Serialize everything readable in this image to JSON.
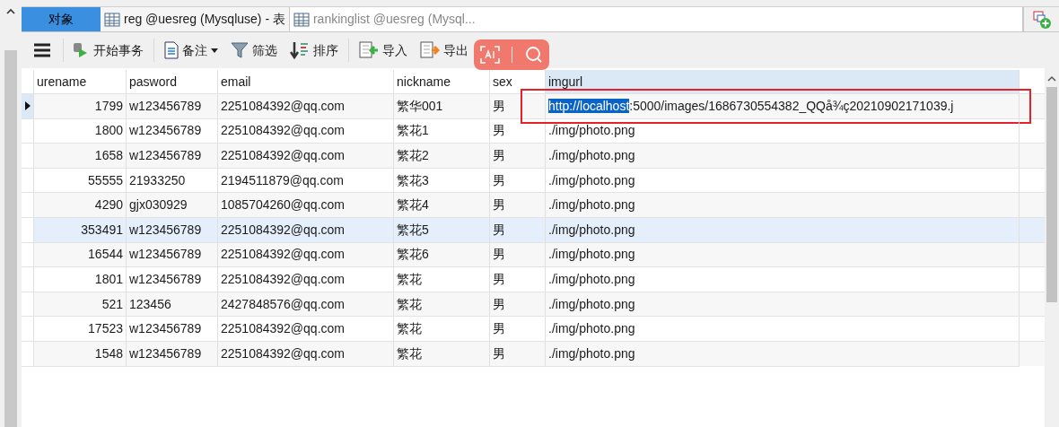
{
  "tabs": [
    {
      "label": "对象",
      "kind": "objects",
      "selected": false
    },
    {
      "label": "reg @uesreg (Mysqluse) - 表",
      "kind": "table",
      "selected": true
    },
    {
      "label": "rankinglist @uesreg (Mysql...",
      "kind": "table",
      "selected": false
    }
  ],
  "toolbar": [
    {
      "kind": "menu"
    },
    {
      "kind": "transaction",
      "label": "开始事务"
    },
    {
      "kind": "divider"
    },
    {
      "kind": "note",
      "label": "备注"
    },
    {
      "kind": "filter",
      "label": "筛选"
    },
    {
      "kind": "sort",
      "label": "排序"
    },
    {
      "kind": "divider"
    },
    {
      "kind": "import",
      "label": "导入"
    },
    {
      "kind": "export",
      "label": "导出"
    }
  ],
  "overlay": {
    "kind": "floating-tools"
  },
  "table": {
    "columns": [
      "urename",
      "pasword",
      "email",
      "nickname",
      "sex",
      "imgurl"
    ],
    "rows": [
      {
        "selected": true,
        "hovered": false,
        "annotated": true,
        "cells": [
          "1799",
          "w123456789",
          "2251084392@qq.com",
          "繁华001",
          "男"
        ],
        "imgurl": [
          {
            "text": "http://localhost",
            "selected": true
          },
          {
            "text": ":5000/images/1686730554382_QQå¾ç20210902171039.j",
            "selected": false
          }
        ]
      },
      {
        "selected": false,
        "hovered": false,
        "annotated": false,
        "cells": [
          "1800",
          "w123456789",
          "2251084392@qq.com",
          "繁花1",
          "男"
        ],
        "imgurl": [
          {
            "text": "./img/photo.png",
            "selected": false
          }
        ]
      },
      {
        "selected": false,
        "hovered": false,
        "annotated": false,
        "cells": [
          "1658",
          "w123456789",
          "2251084392@qq.com",
          "繁花2",
          "男"
        ],
        "imgurl": [
          {
            "text": "./img/photo.png",
            "selected": false
          }
        ]
      },
      {
        "selected": false,
        "hovered": false,
        "annotated": false,
        "cells": [
          "55555",
          "21933250",
          "2194511879@qq.com",
          "繁花3",
          "男"
        ],
        "imgurl": [
          {
            "text": "./img/photo.png",
            "selected": false
          }
        ]
      },
      {
        "selected": false,
        "hovered": false,
        "annotated": false,
        "cells": [
          "4290",
          "gjx030929",
          "1085704260@qq.com",
          "繁花4",
          "男"
        ],
        "imgurl": [
          {
            "text": "./img/photo.png",
            "selected": false
          }
        ]
      },
      {
        "selected": false,
        "hovered": true,
        "annotated": false,
        "cells": [
          "353491",
          "w123456789",
          "2251084392@qq.com",
          "繁花5",
          "男"
        ],
        "imgurl": [
          {
            "text": "./img/photo.png",
            "selected": false
          }
        ]
      },
      {
        "selected": false,
        "hovered": false,
        "annotated": false,
        "cells": [
          "16544",
          "w123456789",
          "2251084392@qq.com",
          "繁花6",
          "男"
        ],
        "imgurl": [
          {
            "text": "./img/photo.png",
            "selected": false
          }
        ]
      },
      {
        "selected": false,
        "hovered": false,
        "annotated": false,
        "cells": [
          "1801",
          "w123456789",
          "2251084392@qq.com",
          "繁花",
          "男"
        ],
        "imgurl": [
          {
            "text": "./img/photo.png",
            "selected": false
          }
        ]
      },
      {
        "selected": false,
        "hovered": false,
        "annotated": false,
        "cells": [
          "521",
          "123456",
          "2427848576@qq.com",
          "繁花",
          "男"
        ],
        "imgurl": [
          {
            "text": "./img/photo.png",
            "selected": false
          }
        ]
      },
      {
        "selected": false,
        "hovered": false,
        "annotated": false,
        "cells": [
          "17523",
          "w123456789",
          "2251084392@qq.com",
          "繁花",
          "男"
        ],
        "imgurl": [
          {
            "text": "./img/photo.png",
            "selected": false
          }
        ]
      },
      {
        "selected": false,
        "hovered": false,
        "annotated": false,
        "cells": [
          "1548",
          "w123456789",
          "2251084392@qq.com",
          "繁花",
          "男"
        ],
        "imgurl": [
          {
            "text": "./img/photo.png",
            "selected": false
          }
        ]
      }
    ]
  }
}
